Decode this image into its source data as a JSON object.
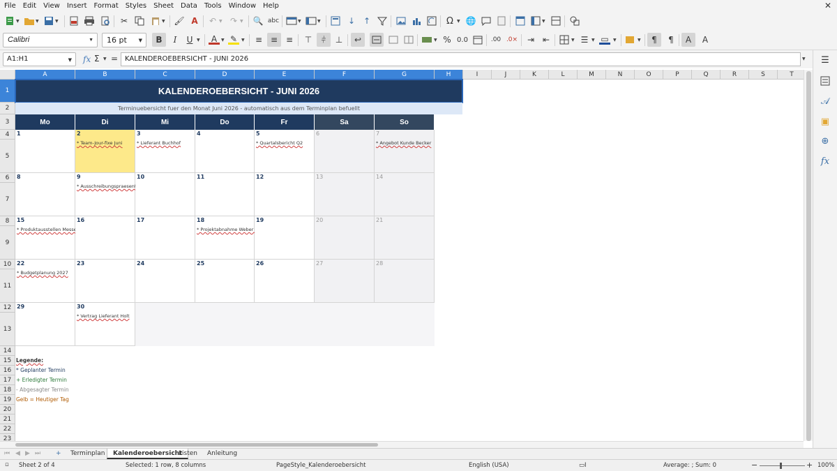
{
  "menu": [
    "File",
    "Edit",
    "View",
    "Insert",
    "Format",
    "Styles",
    "Sheet",
    "Data",
    "Tools",
    "Window",
    "Help"
  ],
  "toolbar": {
    "font_name": "Calibri",
    "font_size": "16 pt"
  },
  "formula_bar": {
    "name_box": "A1:H1",
    "content": "KALENDEROEBERSICHT - JUNI 2026"
  },
  "columns": [
    "A",
    "B",
    "C",
    "D",
    "E",
    "F",
    "G",
    "H",
    "I",
    "J",
    "K",
    "L",
    "M",
    "N",
    "O",
    "P",
    "Q",
    "R",
    "S",
    "T"
  ],
  "rows": [
    "1",
    "2",
    "3",
    "4",
    "5",
    "6",
    "7",
    "8",
    "9",
    "10",
    "11",
    "12",
    "13",
    "14",
    "15",
    "16",
    "17",
    "18",
    "19",
    "20",
    "21",
    "22",
    "23"
  ],
  "sheet": {
    "title": "KALENDEROEBERSICHT - JUNI 2026",
    "subtitle": "Terminuebersicht fuer den Monat Juni 2026 - automatisch aus dem Terminplan befuellt",
    "weekdays": [
      "Mo",
      "Di",
      "Mi",
      "Do",
      "Fr",
      "Sa",
      "So"
    ],
    "weeks": [
      [
        {
          "d": "1",
          "ev": ""
        },
        {
          "d": "2",
          "ev": "* Team-Jour-fixe Juni",
          "today": true
        },
        {
          "d": "3",
          "ev": "* Lieferant Buchhof"
        },
        {
          "d": "4",
          "ev": ""
        },
        {
          "d": "5",
          "ev": "* Quartalsbericht Q2"
        },
        {
          "d": "6",
          "ev": ""
        },
        {
          "d": "7",
          "ev": "* Angebot Kunde Becker"
        }
      ],
      [
        {
          "d": "8",
          "ev": ""
        },
        {
          "d": "9",
          "ev": "* Ausschreibungspraesentation"
        },
        {
          "d": "10",
          "ev": ""
        },
        {
          "d": "11",
          "ev": ""
        },
        {
          "d": "12",
          "ev": ""
        },
        {
          "d": "13",
          "ev": ""
        },
        {
          "d": "14",
          "ev": ""
        }
      ],
      [
        {
          "d": "15",
          "ev": "* Produktausstellen Messe"
        },
        {
          "d": "16",
          "ev": ""
        },
        {
          "d": "17",
          "ev": ""
        },
        {
          "d": "18",
          "ev": "* Projektabnahme Weber G"
        },
        {
          "d": "19",
          "ev": ""
        },
        {
          "d": "20",
          "ev": ""
        },
        {
          "d": "21",
          "ev": ""
        }
      ],
      [
        {
          "d": "22",
          "ev": "* Budgetplanung 2027"
        },
        {
          "d": "23",
          "ev": ""
        },
        {
          "d": "24",
          "ev": ""
        },
        {
          "d": "25",
          "ev": ""
        },
        {
          "d": "26",
          "ev": ""
        },
        {
          "d": "27",
          "ev": ""
        },
        {
          "d": "28",
          "ev": ""
        }
      ],
      [
        {
          "d": "29",
          "ev": ""
        },
        {
          "d": "30",
          "ev": "* Vertrag Lieferant Holt"
        }
      ]
    ],
    "legend": {
      "heading": "Legende:",
      "items": [
        "* Geplanter Termin",
        "+ Erledigter Termin",
        "- Abgesagter Termin",
        "Gelb = Heutiger Tag"
      ]
    }
  },
  "tabs": [
    "Terminplan",
    "Kalenderoebersicht",
    "Listen",
    "Anleitung"
  ],
  "active_tab": "Kalenderoebersicht",
  "status": {
    "sheet": "Sheet 2 of 4",
    "selection": "Selected: 1 row, 8 columns",
    "page_style": "PageStyle_Kalenderoebersicht",
    "language": "English (USA)",
    "summary": "Average: ; Sum: 0",
    "zoom": "100%"
  },
  "colors": {
    "header_navy": "#1f3a5f",
    "today_yellow": "#fde98a",
    "selection_blue": "#3c84d9"
  }
}
